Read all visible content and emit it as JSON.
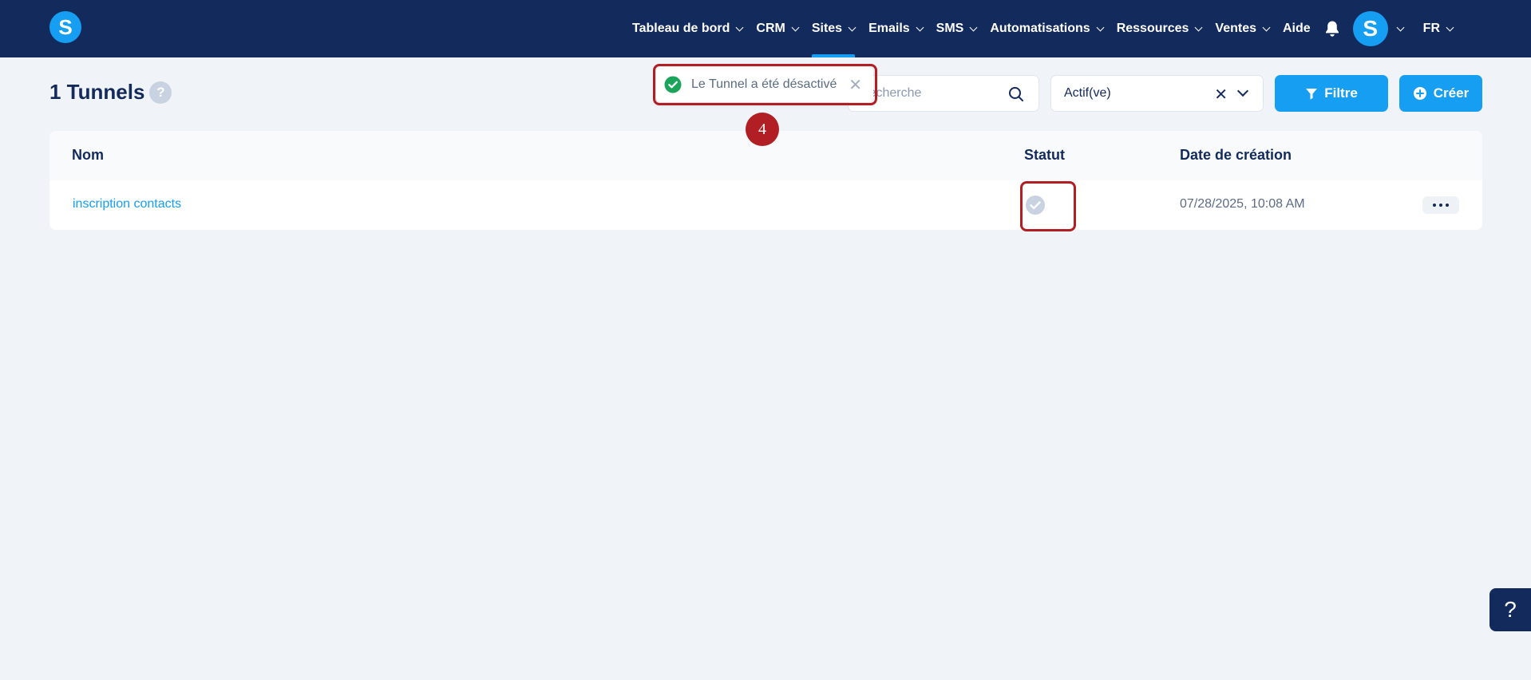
{
  "app": {
    "logo_letter": "S",
    "avatar_letter": "S"
  },
  "nav": {
    "items": [
      {
        "label": "Tableau de bord",
        "has_menu": true,
        "active": false
      },
      {
        "label": "CRM",
        "has_menu": true,
        "active": false
      },
      {
        "label": "Sites",
        "has_menu": true,
        "active": true
      },
      {
        "label": "Emails",
        "has_menu": true,
        "active": false
      },
      {
        "label": "SMS",
        "has_menu": true,
        "active": false
      },
      {
        "label": "Automatisations",
        "has_menu": true,
        "active": false
      },
      {
        "label": "Ressources",
        "has_menu": true,
        "active": false
      },
      {
        "label": "Ventes",
        "has_menu": true,
        "active": false
      },
      {
        "label": "Aide",
        "has_menu": false,
        "active": false
      }
    ],
    "language": "FR"
  },
  "page": {
    "title": "1 Tunnels",
    "help_mark": "?"
  },
  "search": {
    "placeholder": "Recherche",
    "value": ""
  },
  "status_filter": {
    "selected": "Actif(ve)",
    "clear_glyph": "✕"
  },
  "buttons": {
    "filter": "Filtre",
    "create": "Créer"
  },
  "table": {
    "columns": {
      "name": "Nom",
      "status": "Statut",
      "created": "Date de création"
    },
    "rows": [
      {
        "name": "inscription contacts",
        "status": "inactive",
        "created": "07/28/2025, 10:08 AM"
      }
    ]
  },
  "toast": {
    "message": "Le Tunnel a été désactivé",
    "close_glyph": "✕"
  },
  "annotation": {
    "step_number": "4"
  },
  "help_fab": {
    "label": "?"
  },
  "colors": {
    "navbar": "#132a5c",
    "accent": "#169ef3",
    "success": "#1aa55b",
    "status_inactive": "#c8d2e0",
    "highlight": "#b11f24"
  }
}
